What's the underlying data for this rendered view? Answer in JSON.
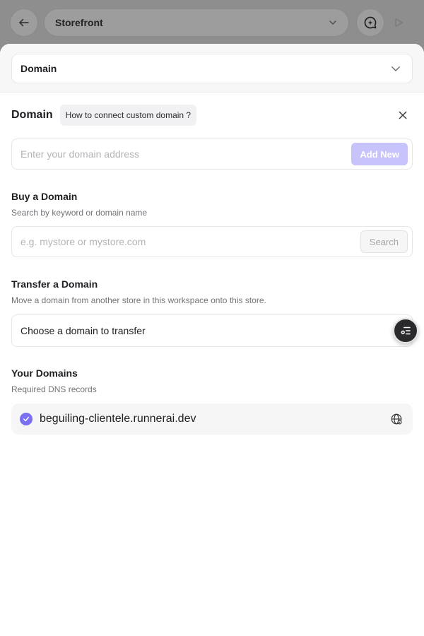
{
  "topbar": {
    "store_name": "Storefront",
    "icons": {
      "back": "arrow-left-icon",
      "dropdown": "chevron-down-icon",
      "chat": "chat-sparkle-icon",
      "play": "play-icon"
    }
  },
  "sheet": {
    "section_select": {
      "label": "Domain"
    },
    "header": {
      "title": "Domain",
      "help_link": "How to connect custom domain ?"
    },
    "add_domain": {
      "placeholder": "Enter your domain address",
      "button": "Add New"
    },
    "buy": {
      "title": "Buy a Domain",
      "subtitle": "Search by keyword or domain name",
      "placeholder": "e.g. mystore or mystore.com",
      "button": "Search"
    },
    "transfer": {
      "title": "Transfer a Domain",
      "subtitle": "Move a domain from another store in this workspace onto this store.",
      "select_label": "Choose a domain to transfer"
    },
    "your_domains": {
      "title": "Your Domains",
      "subtitle": "Required DNS records",
      "items": [
        {
          "name": "beguiling-clientele.runnerai.dev",
          "verified": true
        }
      ]
    }
  },
  "colors": {
    "accent": "#7b6ff2",
    "accent_light": "#c7c3fb",
    "overlay": "#8e8e8e"
  }
}
